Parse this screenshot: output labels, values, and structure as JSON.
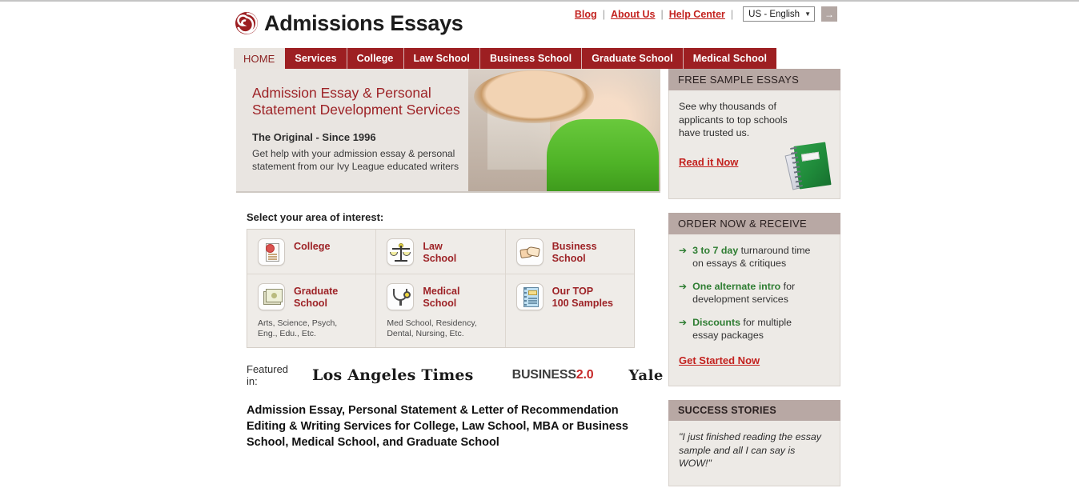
{
  "header": {
    "brand": "Admissions Essays",
    "logo_icon": "spiral-logo-icon",
    "top_links": [
      {
        "label": "Blog"
      },
      {
        "label": "About Us"
      },
      {
        "label": "Help Center"
      }
    ],
    "separator": "|",
    "language_select": {
      "value": "US - English",
      "caret": "▼"
    },
    "go_button": {
      "icon": "arrow-right-icon",
      "glyph": "→"
    }
  },
  "nav": {
    "tabs": [
      {
        "label": "HOME",
        "active": true
      },
      {
        "label": "Services",
        "active": false
      },
      {
        "label": "College",
        "active": false
      },
      {
        "label": "Law School",
        "active": false
      },
      {
        "label": "Business School",
        "active": false
      },
      {
        "label": "Graduate School",
        "active": false
      },
      {
        "label": "Medical School",
        "active": false
      }
    ]
  },
  "hero": {
    "heading_line1": "Admission Essay & Personal",
    "heading_line2": "Statement Development Services",
    "tagline": "The Original - Since 1996",
    "body_line1": "Get help with your admission essay & personal",
    "body_line2": "statement from our Ivy League educated writers",
    "photo_alt": "smiling-student-photo"
  },
  "interest": {
    "title": "Select your area of interest:",
    "items": [
      {
        "label": "College",
        "label2": "",
        "note": "",
        "icon": "certificate-document-icon"
      },
      {
        "label": "Law",
        "label2": "School",
        "note": "",
        "icon": "scales-of-justice-icon"
      },
      {
        "label": "Business",
        "label2": "School",
        "note": "",
        "icon": "handshake-icon"
      },
      {
        "label": "Graduate",
        "label2": "School",
        "note_line1": "Arts, Science, Psych,",
        "note_line2": "Eng., Edu., Etc.",
        "icon": "diploma-icon"
      },
      {
        "label": "Medical",
        "label2": "School",
        "note_line1": "Med School, Residency,",
        "note_line2": "Dental, Nursing, Etc.",
        "icon": "stethoscope-icon"
      },
      {
        "label": "Our TOP",
        "label2": "100 Samples",
        "note_line1": "",
        "note_line2": "",
        "icon": "notebook-samples-icon"
      }
    ]
  },
  "featured": {
    "label": "Featured in:",
    "logos": [
      {
        "name": "los-angeles-times-logo",
        "text": "Los Angeles Times"
      },
      {
        "name": "business-2-0-logo",
        "text_main": "BUSINESS",
        "text_accent": "2.0"
      },
      {
        "name": "yale-news-logo",
        "text": "Yale News"
      }
    ]
  },
  "bottom_heading": {
    "line1": "Admission Essay, Personal Statement & Letter of",
    "line2": "Recommendation Editing & Writing Services for College, Law",
    "line3": "School, MBA or Business School, Medical School, and",
    "line4": "Graduate School"
  },
  "sidebar": {
    "free_samples": {
      "title": "FREE SAMPLE ESSAYS",
      "body_line1": "See why thousands of",
      "body_line2": "applicants to top schools",
      "body_line3": "have trusted us.",
      "link": "Read it Now",
      "icon": "green-notebook-icon"
    },
    "order_now": {
      "title": "ORDER NOW & RECEIVE",
      "bullets": [
        {
          "arrow": "➔",
          "strong": "3 to 7 day",
          "rest": " turnaround time",
          "second_line": "on essays & critiques"
        },
        {
          "arrow": "➔",
          "strong": "One alternate intro",
          "rest": " for",
          "second_line": "development services"
        },
        {
          "arrow": "➔",
          "strong": "Discounts",
          "rest": " for multiple",
          "second_line": "essay packages"
        }
      ],
      "link": "Get Started Now"
    },
    "success_stories": {
      "title": "SUCCESS STORIES",
      "quote_line1": "\"I just finished reading the essay",
      "quote_line2": "sample and all I can say is",
      "quote_line3": "WOW!\""
    }
  },
  "colors": {
    "brand_red": "#9d1f22",
    "link_red": "#c3221f",
    "panel_header": "#b8a8a4",
    "panel_body": "#edeae6",
    "hero_bg": "#e9e5e1",
    "bullet_green": "#2e7d32"
  }
}
